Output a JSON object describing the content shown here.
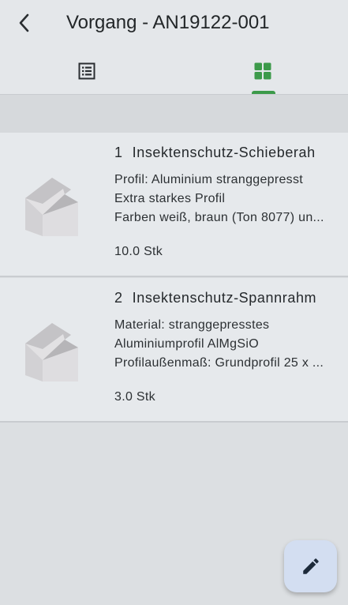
{
  "header": {
    "title": "Vorgang - AN19122-001",
    "back_icon": "chevron-left-icon"
  },
  "tabs": [
    {
      "name": "list",
      "icon": "list-icon",
      "active": false
    },
    {
      "name": "grid",
      "icon": "grid-icon",
      "active": true
    }
  ],
  "colors": {
    "accent": "#3c9a4a",
    "fab_background": "#d3def1"
  },
  "items": [
    {
      "number": "1",
      "title": "Insektenschutz-Schieberah",
      "lines": [
        "Profil: Aluminium stranggepresst",
        "Extra starkes Profil",
        "Farben weiß, braun (Ton 8077) un..."
      ],
      "quantity": "10.0 Stk",
      "thumbnail_icon": "box-placeholder-icon"
    },
    {
      "number": "2",
      "title": "Insektenschutz-Spannrahm",
      "lines": [
        "Material: stranggepresstes",
        "Aluminiumprofil AlMgSiO",
        "Profilaußenmaß: Grundprofil 25 x ..."
      ],
      "quantity": "3.0 Stk",
      "thumbnail_icon": "box-placeholder-icon"
    }
  ],
  "fab": {
    "icon": "pencil-icon"
  }
}
